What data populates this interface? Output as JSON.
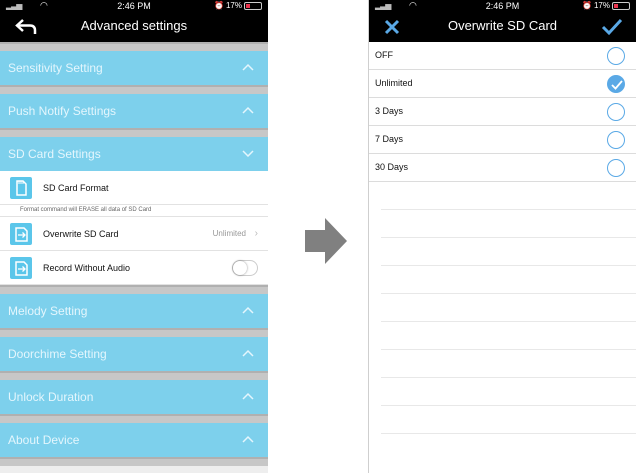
{
  "left": {
    "status": {
      "time": "2:46 PM",
      "battery": "17%"
    },
    "title": "Advanced settings",
    "sections": [
      "Sensitivity Setting",
      "Push Notify Settings",
      "SD Card Settings",
      "Melody Setting",
      "Doorchime Setting",
      "Unlock Duration",
      "About Device"
    ],
    "sd": {
      "format_label": "SD Card Format",
      "warning": "Format command will ERASE all data of SD Card",
      "overwrite_label": "Overwrite SD Card",
      "overwrite_value": "Unlimited",
      "record_label": "Record Without Audio"
    }
  },
  "right": {
    "status": {
      "time": "2:46 PM",
      "battery": "17%"
    },
    "title": "Overwrite SD Card",
    "options": [
      "OFF",
      "Unlimited",
      "3 Days",
      "7 Days",
      "30 Days"
    ],
    "selected": "Unlimited"
  },
  "colors": {
    "section_header": "#7dd0ec",
    "accent": "#5aa9e6",
    "navbar": "#000000"
  }
}
